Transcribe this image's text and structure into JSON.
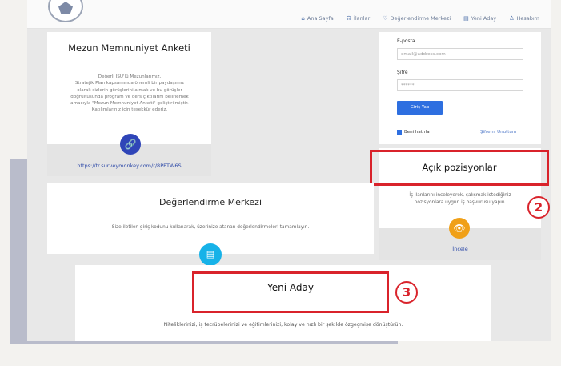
{
  "nav": {
    "items": [
      {
        "icon": "home-icon",
        "glyph": "⌂",
        "label": "Ana Sayfa"
      },
      {
        "icon": "announcement-icon",
        "glyph": "☊",
        "label": "İlanlar"
      },
      {
        "icon": "heart-icon",
        "glyph": "♡",
        "label": "Değerlendirme Merkezi"
      },
      {
        "icon": "document-icon",
        "glyph": "▤",
        "label": "Yeni Aday"
      },
      {
        "icon": "user-icon",
        "glyph": "♙",
        "label": "Hesabım"
      }
    ]
  },
  "anket": {
    "title": "Mezun Memnuniyet Anketi",
    "body_lines": [
      "Değerli İSÜ'lü Mezunlarımız,",
      "Stratejik Plan kapsamında önemli bir paydaşımız",
      "olarak sizlerin görüşlerini almak ve bu görüşler",
      "doğrultusunda program ve ders çıktılarını belirlemek",
      "amacıyla \"Mezun Memnuniyet Anketi\" geliştirilmiştir.",
      "Katılımlarınız için teşekkür ederiz."
    ],
    "link": "https://tr.surveymonkey.com/r/8PPTW6S"
  },
  "login": {
    "email_label": "E-posta",
    "email_placeholder": "email@address.com",
    "password_label": "Şifre",
    "password_value": "******",
    "submit": "Giriş Yap",
    "remember": "Beni hatırla",
    "forgot": "Şifremi Unuttum"
  },
  "acik": {
    "title": "Açık pozisyonlar",
    "desc_lines": [
      "İş ilanlarını inceleyerek, çalışmak istediğiniz",
      "pozisyonlara uygun iş başvurusu yapın."
    ],
    "action": "İncele"
  },
  "degerlendirme": {
    "title": "Değerlendirme Merkezi",
    "desc": "Size iletilen giriş kodunu kullanarak, üzerinize atanan değerlendirmeleri tamamlayın."
  },
  "yeni_aday": {
    "title": "Yeni Aday",
    "desc": "Niteliklerinizi, iş tecrübelerinizi ve eğitimlerinizi, kolay ve hızlı bir şekilde özgeçmişe dönüştürün."
  },
  "badges": {
    "two": "2",
    "three": "3"
  },
  "colors": {
    "highlight": "#d9232b",
    "primary": "#2e6fe0",
    "link": "#2e4aa8"
  }
}
